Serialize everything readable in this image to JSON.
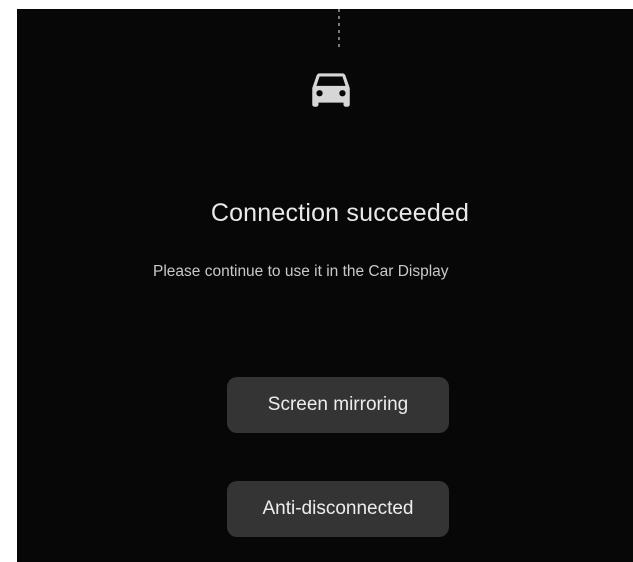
{
  "dialog": {
    "icon": "car-icon",
    "title": "Connection succeeded",
    "message": "Please continue to use it in the Car Display"
  },
  "actions": {
    "screen_mirroring_label": "Screen mirroring",
    "anti_disconnected_label": "Anti-disconnected"
  },
  "colors": {
    "background": "#070707",
    "button_bg": "#343434",
    "text_primary": "#e9e9e9",
    "icon": "#d6d6d6"
  }
}
